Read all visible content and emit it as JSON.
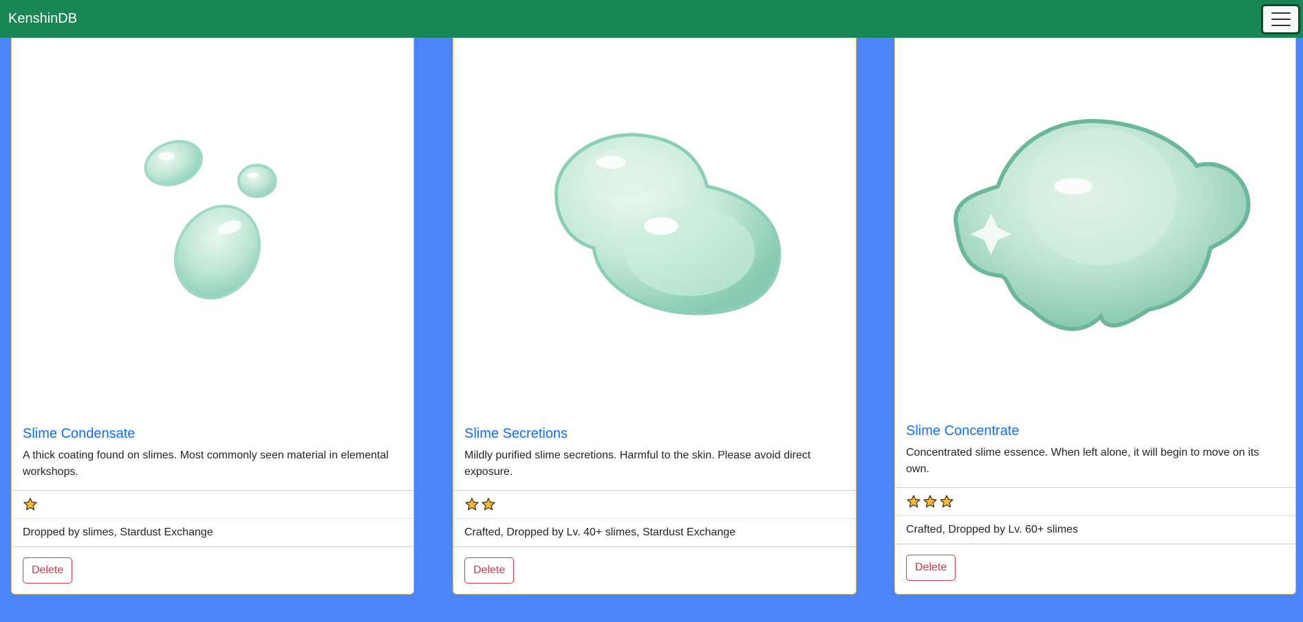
{
  "navbar": {
    "brand": "KenshinDB",
    "toggler_icon": "hamburger-menu-icon"
  },
  "cards": [
    {
      "title": "Slime Condensate",
      "description": "A thick coating found on slimes. Most commonly seen material in elemental workshops.",
      "rarity_stars": 1,
      "source": "Dropped by slimes, Stardust Exchange",
      "delete_label": "Delete",
      "image_icon": "slime-condensate-image"
    },
    {
      "title": "Slime Secretions",
      "description": "Mildly purified slime secretions. Harmful to the skin. Please avoid direct exposure.",
      "rarity_stars": 2,
      "source": "Crafted, Dropped by Lv. 40+ slimes, Stardust Exchange",
      "delete_label": "Delete",
      "image_icon": "slime-secretions-image"
    },
    {
      "title": "Slime Concentrate",
      "description": "Concentrated slime essence. When left alone, it will begin to move on its own.",
      "rarity_stars": 3,
      "source": "Crafted, Dropped by Lv. 60+ slimes",
      "delete_label": "Delete",
      "image_icon": "slime-concentrate-image"
    }
  ],
  "colors": {
    "navbar": "#198754",
    "page_background": "#4c84fc",
    "title_link": "#0d6efd",
    "delete_button": "#dc3545",
    "star_fill": "#f5b82e"
  }
}
